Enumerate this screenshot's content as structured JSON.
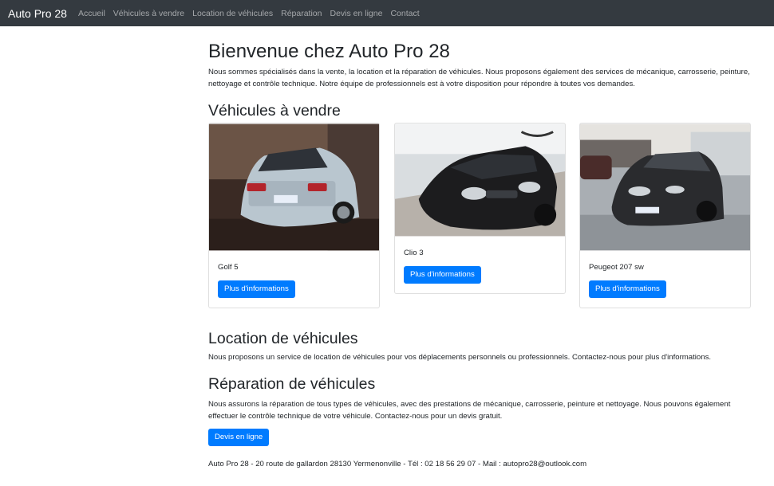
{
  "navbar": {
    "brand": "Auto Pro 28",
    "links": [
      "Accueil",
      "Véhicules à vendre",
      "Location de véhicules",
      "Réparation",
      "Devis en ligne",
      "Contact"
    ]
  },
  "hero": {
    "title": "Bienvenue chez Auto Pro 28",
    "text": "Nous sommes spécialisés dans la vente, la location et la réparation de véhicules. Nous proposons également des services de mécanique, carrosserie, peinture, nettoyage et contrôle technique. Notre équipe de professionnels est à votre disposition pour répondre à toutes vos demandes."
  },
  "sale": {
    "title": "Véhicules à vendre",
    "cars": [
      {
        "name": "Golf 5",
        "button": "Plus d'informations",
        "color": "#b9c6cf"
      },
      {
        "name": "Clio 3",
        "button": "Plus d'informations",
        "color": "#1c1c1e"
      },
      {
        "name": "Peugeot 207 sw",
        "button": "Plus d'informations",
        "color": "#2a2b2e"
      }
    ]
  },
  "rental": {
    "title": "Location de véhicules",
    "text": "Nous proposons un service de location de véhicules pour vos déplacements personnels ou professionnels. Contactez-nous pour plus d'informations."
  },
  "repair": {
    "title": "Réparation de véhicules",
    "text": "Nous assurons la réparation de tous types de véhicules, avec des prestations de mécanique, carrosserie, peinture et nettoyage. Nous pouvons également effectuer le contrôle technique de votre véhicule. Contactez-nous pour un devis gratuit.",
    "button": "Devis en ligne"
  },
  "footer": {
    "text": "Auto Pro 28 - 20 route de gallardon 28130 Yermenonville - Tél : 02 18 56 29 07 - Mail : autopro28@outlook.com"
  },
  "colors": {
    "navbar": "#343a40",
    "primary": "#007bff"
  }
}
